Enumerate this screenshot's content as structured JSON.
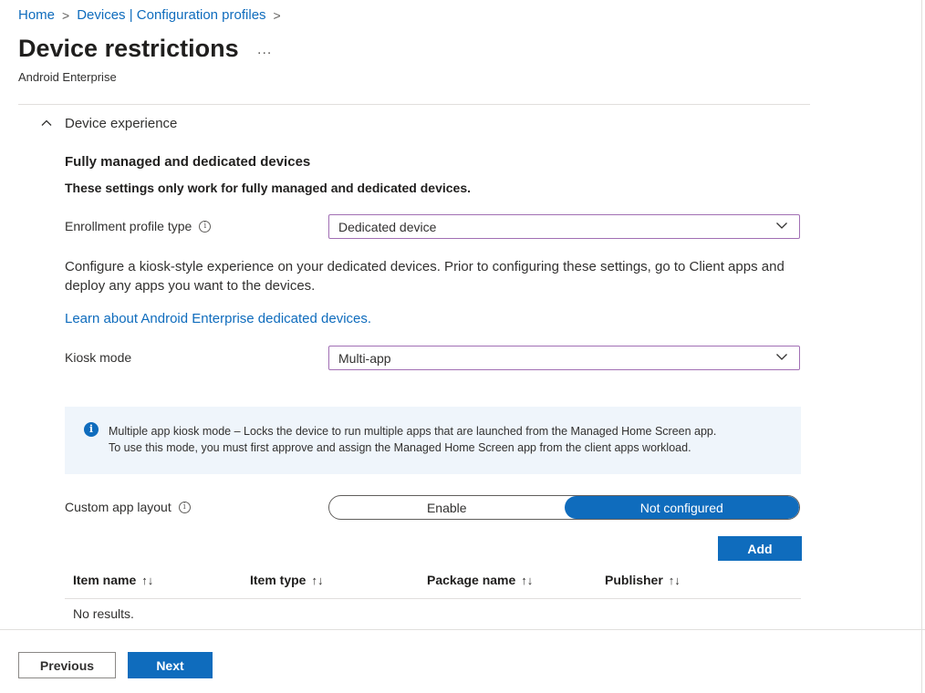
{
  "breadcrumb": {
    "home": "Home",
    "devices": "Devices | Configuration profiles",
    "separator": ">"
  },
  "page": {
    "title": "Device restrictions",
    "more": "...",
    "subtitle": "Android Enterprise"
  },
  "section": {
    "label": "Device experience",
    "heading": "Fully managed and dedicated devices",
    "note": "These settings only work for fully managed and dedicated devices."
  },
  "enrollment": {
    "label": "Enrollment profile type",
    "value": "Dedicated device"
  },
  "description": "Configure a kiosk-style experience on your dedicated devices. Prior to configuring these settings, go to Client apps and deploy any apps you want to the devices.",
  "learn_link": "Learn about Android Enterprise dedicated devices.",
  "kiosk": {
    "label": "Kiosk mode",
    "value": "Multi-app"
  },
  "info": {
    "line1": "Multiple app kiosk mode – Locks the device to run multiple apps that are launched from the Managed Home Screen app.",
    "line2": "To use this mode, you must first approve and assign the Managed Home Screen app from the client apps workload."
  },
  "custom_layout": {
    "label": "Custom app layout",
    "options": [
      "Enable",
      "Not configured"
    ],
    "selected": "Not configured"
  },
  "add_button": "Add",
  "table": {
    "columns": [
      "Item name",
      "Item type",
      "Package name",
      "Publisher"
    ],
    "sort_glyph": "↑↓",
    "empty": "No results."
  },
  "footer": {
    "previous": "Previous",
    "next": "Next"
  },
  "colors": {
    "accent": "#0f6cbd",
    "focus_border": "#a16fb4",
    "info_bg": "#eff5fb"
  }
}
